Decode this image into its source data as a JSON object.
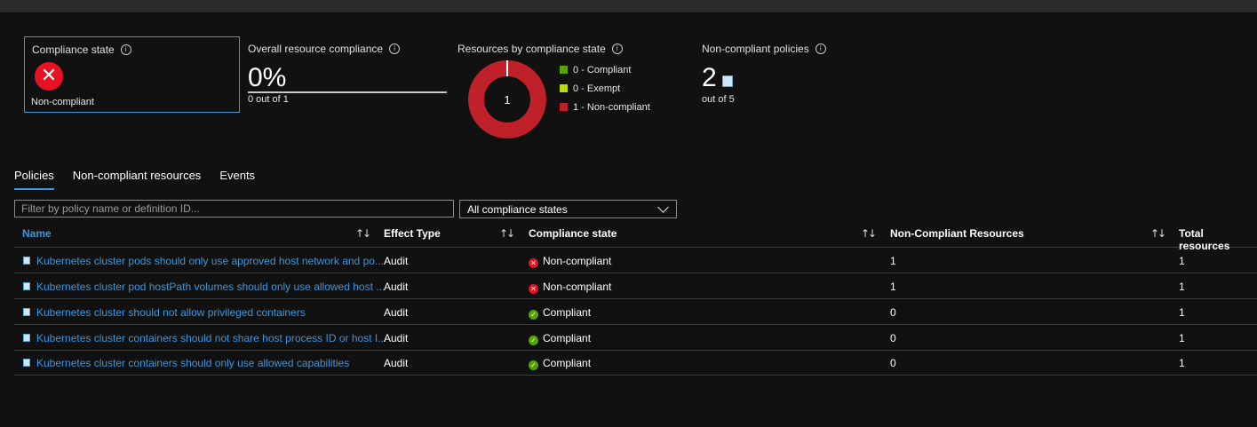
{
  "summary": {
    "compliance_state": {
      "title": "Compliance state",
      "info_icon": "info-icon",
      "status_icon": "error-circle-icon",
      "value": "Non-compliant"
    },
    "overall": {
      "title": "Overall resource compliance",
      "value": "0%",
      "sub": "0 out of 1"
    },
    "by_state": {
      "title": "Resources by compliance state",
      "center": "1",
      "legend": [
        {
          "label": "0 - Compliant",
          "color": "#57a300"
        },
        {
          "label": "0 - Exempt",
          "color": "#bad80a"
        },
        {
          "label": "1 - Non-compliant",
          "color": "#c0202a"
        }
      ]
    },
    "policies": {
      "title": "Non-compliant policies",
      "value": "2",
      "sub": "out of 5"
    }
  },
  "chart_data": {
    "type": "pie",
    "categories": [
      "Compliant",
      "Exempt",
      "Non-compliant"
    ],
    "values": [
      0,
      0,
      1
    ],
    "title": "Resources by compliance state"
  },
  "tabs": [
    {
      "label": "Policies",
      "active": true
    },
    {
      "label": "Non-compliant resources",
      "active": false
    },
    {
      "label": "Events",
      "active": false
    }
  ],
  "filter": {
    "placeholder": "Filter by policy name or definition ID..."
  },
  "dropdown": {
    "value": "All compliance states"
  },
  "table": {
    "headers": {
      "name": "Name",
      "effect": "Effect Type",
      "state": "Compliance state",
      "noncompliant": "Non-Compliant Resources",
      "total": "Total resources"
    },
    "sort_glyph": "↑↓",
    "rows": [
      {
        "name": "Kubernetes cluster pods should only use approved host network and po...",
        "effect": "Audit",
        "state": "Non-compliant",
        "status": "bad",
        "noncompliant": "1",
        "total": "1"
      },
      {
        "name": "Kubernetes cluster pod hostPath volumes should only use allowed host ...",
        "effect": "Audit",
        "state": "Non-compliant",
        "status": "bad",
        "noncompliant": "1",
        "total": "1"
      },
      {
        "name": "Kubernetes cluster should not allow privileged containers",
        "effect": "Audit",
        "state": "Compliant",
        "status": "good",
        "noncompliant": "0",
        "total": "1"
      },
      {
        "name": "Kubernetes cluster containers should not share host process ID or host I...",
        "effect": "Audit",
        "state": "Compliant",
        "status": "good",
        "noncompliant": "0",
        "total": "1"
      },
      {
        "name": "Kubernetes cluster containers should only use allowed capabilities",
        "effect": "Audit",
        "state": "Compliant",
        "status": "good",
        "noncompliant": "0",
        "total": "1"
      }
    ]
  }
}
